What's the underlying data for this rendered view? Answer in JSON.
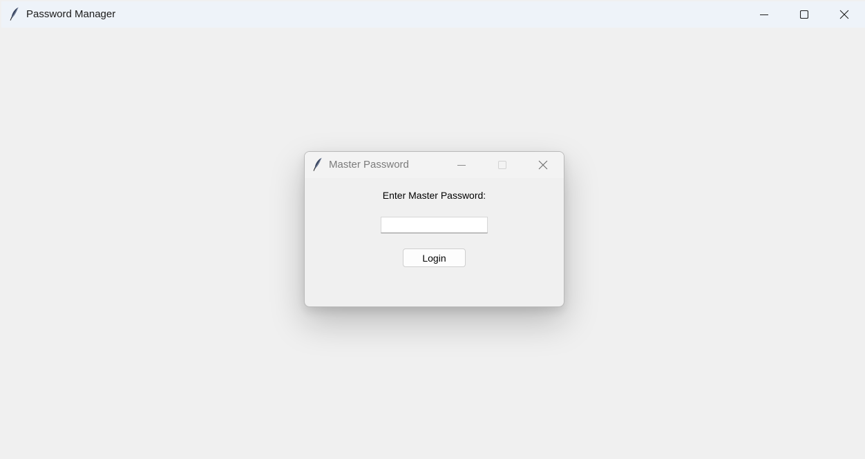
{
  "main_window": {
    "title": "Password Manager",
    "app_icon": "feather-icon",
    "controls": [
      "minimize-icon",
      "maximize-icon",
      "close-icon"
    ]
  },
  "dialog": {
    "title": "Master Password",
    "app_icon": "feather-icon",
    "controls": [
      "minimize-icon",
      "maximize-icon",
      "close-icon"
    ],
    "prompt": "Enter Master Password:",
    "password_value": "",
    "login_label": "Login"
  },
  "colors": {
    "window_bg": "#f0f0f0",
    "main_titlebar_bg": "#eef3f9",
    "dialog_title_text": "#7b7b7b"
  }
}
